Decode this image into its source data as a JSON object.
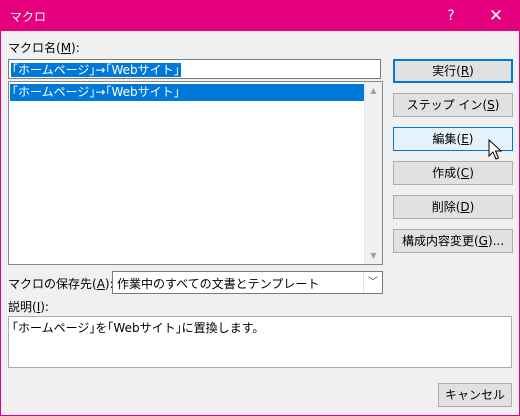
{
  "window": {
    "title": "マクロ",
    "help_icon": "?",
    "close_icon": "✕"
  },
  "macro_name": {
    "label": "マクロ名(M):",
    "label_pre": "マクロ名(",
    "label_key": "M",
    "label_post": "):",
    "value": "｢ホームページ｣→｢Webサイト｣"
  },
  "macro_list": {
    "items": [
      "｢ホームページ｣→｢Webサイト｣"
    ],
    "selected_index": 0
  },
  "buttons": [
    {
      "pre": "実行(",
      "key": "R",
      "post": ")"
    },
    {
      "pre": "ステップ イン(",
      "key": "S",
      "post": ")"
    },
    {
      "pre": "編集(",
      "key": "E",
      "post": ")"
    },
    {
      "pre": "作成(",
      "key": "C",
      "post": ")"
    },
    {
      "pre": "削除(",
      "key": "D",
      "post": ")"
    },
    {
      "pre": "構成内容変更(",
      "key": "G",
      "post": ")..."
    }
  ],
  "macro_in": {
    "label_pre": "マクロの保存先(",
    "label_key": "A",
    "label_post": "):",
    "value": "作業中のすべての文書とテンプレート"
  },
  "description": {
    "label_pre": "説明(",
    "label_key": "I",
    "label_post": "):",
    "value": "｢ホームページ｣を｢Webサイト｣に置換します。"
  },
  "cancel": {
    "label": "キャンセル"
  }
}
